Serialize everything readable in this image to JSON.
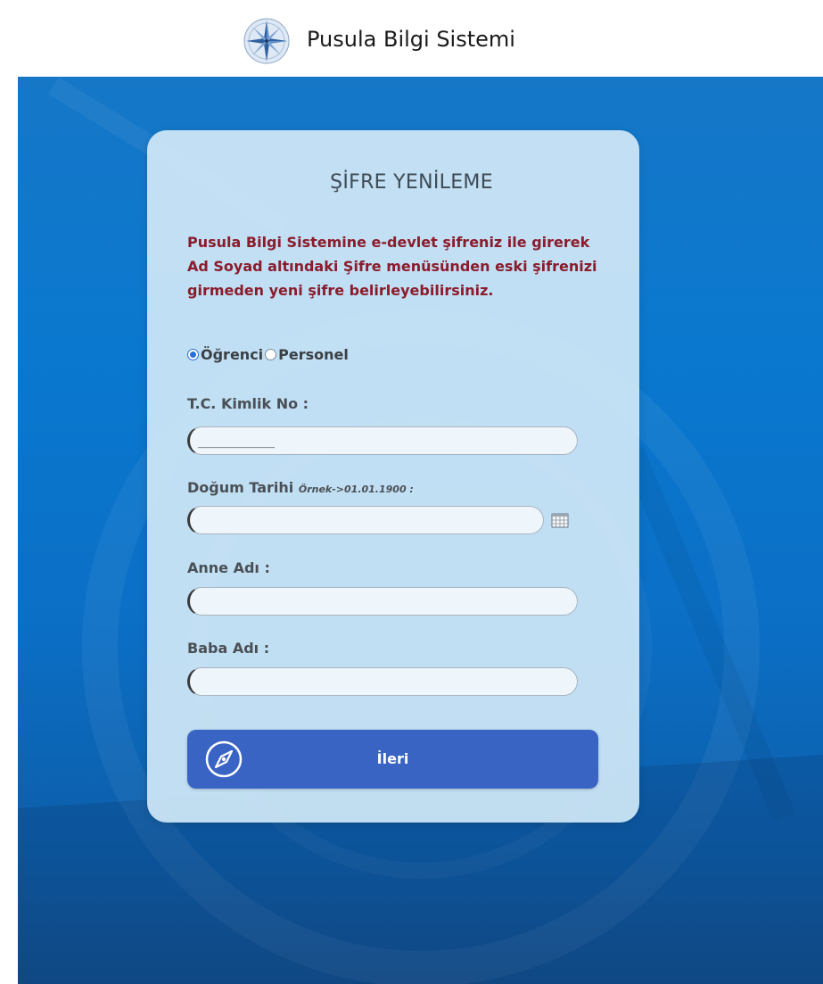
{
  "header": {
    "site_title": "Pusula Bilgi Sistemi",
    "logo_icon": "compass-rose-icon"
  },
  "form": {
    "title": "ŞİFRE YENİLEME",
    "notice_lines": [
      "Pusula Bilgi Sistemine e-devlet şifreniz ile girerek",
      "Ad Soyad altındaki Şifre menüsünden eski şifrenizi",
      "girmeden yeni şifre belirleyebilirsiniz."
    ],
    "user_type": {
      "options": [
        "Öğrenci",
        "Personel"
      ],
      "selected": "Öğrenci"
    },
    "tc_kimlik": {
      "label": "T.C. Kimlik No :",
      "value": "___________"
    },
    "dogum_tarihi": {
      "label": "Doğum Tarihi",
      "hint": "Örnek->01.01.1900 :",
      "value": "",
      "calendar_icon": "calendar-icon"
    },
    "anne_adi": {
      "label": "Anne Adı :",
      "value": ""
    },
    "baba_adi": {
      "label": "Baba Adı :",
      "value": ""
    },
    "submit": {
      "label": "İleri",
      "icon": "compass-icon"
    }
  },
  "colors": {
    "hero_blue": "#0a78cf",
    "card_bg": "#d0e7f6",
    "notice_text": "#8a1c2b",
    "button_bg": "#3a64c4"
  }
}
